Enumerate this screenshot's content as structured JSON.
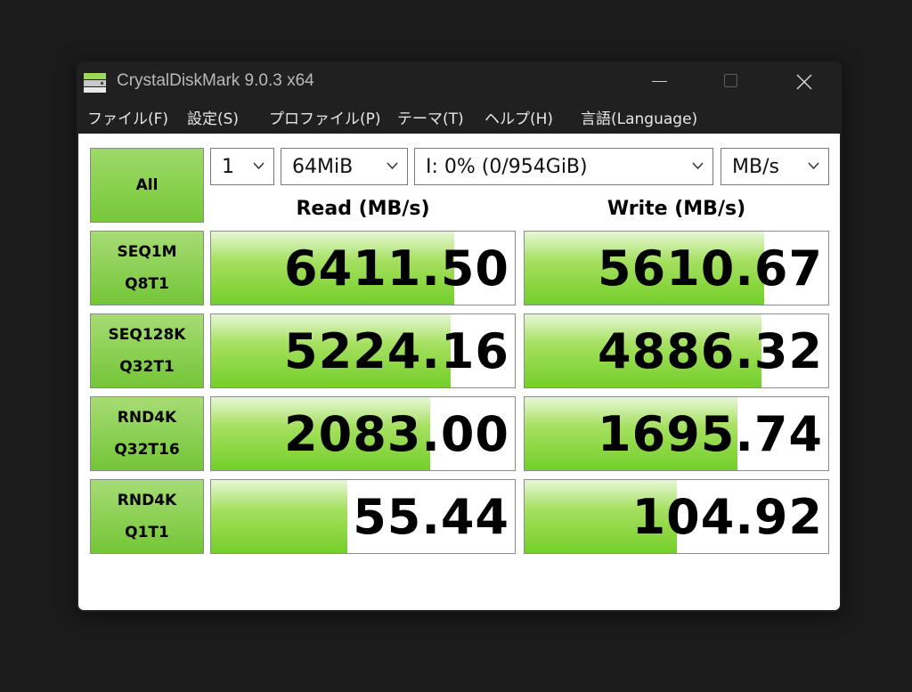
{
  "window": {
    "title": "CrystalDiskMark 9.0.3 x64"
  },
  "menu": {
    "items": [
      "ファイル(F)",
      "設定(S)",
      "プロファイル(P)",
      "テーマ(T)",
      "ヘルプ(H)",
      "言語(Language)"
    ]
  },
  "controls": {
    "all_label": "All",
    "count": "1",
    "size": "64MiB",
    "drive": "I: 0% (0/954GiB)",
    "unit": "MB/s"
  },
  "headers": {
    "read": "Read (MB/s)",
    "write": "Write (MB/s)"
  },
  "tests": [
    {
      "name": "SEQ1M",
      "params": "Q8T1",
      "read": "6411.50",
      "write": "5610.67",
      "read_fill": 0.8,
      "write_fill": 0.79
    },
    {
      "name": "SEQ128K",
      "params": "Q32T1",
      "read": "5224.16",
      "write": "4886.32",
      "read_fill": 0.79,
      "write_fill": 0.78
    },
    {
      "name": "RND4K",
      "params": "Q32T16",
      "read": "2083.00",
      "write": "1695.74",
      "read_fill": 0.72,
      "write_fill": 0.7
    },
    {
      "name": "RND4K",
      "params": "Q1T1",
      "read": "55.44",
      "write": "104.92",
      "read_fill": 0.45,
      "write_fill": 0.5
    }
  ],
  "comment": "",
  "colors": {
    "accent_green": "#74cf2a",
    "window_bg": "#202020"
  }
}
